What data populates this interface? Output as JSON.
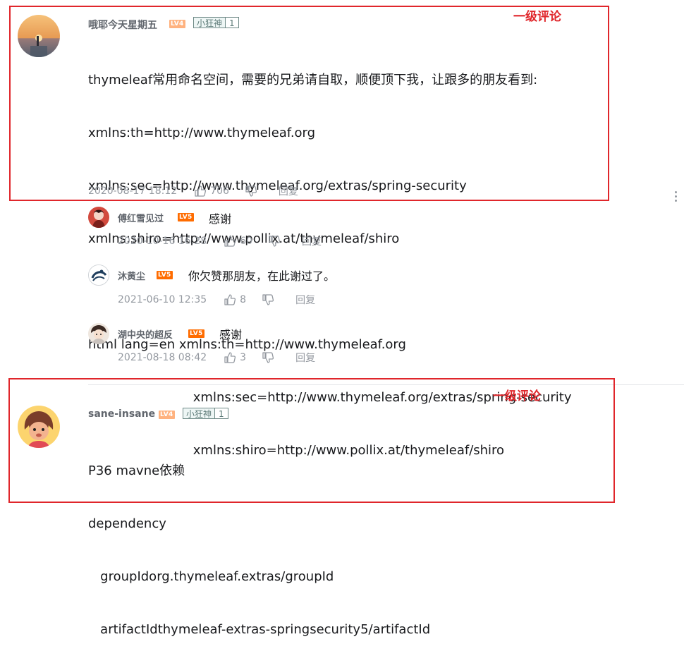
{
  "annotations": {
    "label_1": "一级评论",
    "label_2": "一级评论",
    "color": "#e0262b"
  },
  "comments": [
    {
      "username": "哦耶今天星期五",
      "level": "LV4",
      "fan_badge": {
        "name": "小狂神",
        "level": "1"
      },
      "lines": [
        "thymeleaf常用命名空间，需要的兄弟请自取，顺便顶下我，让跟多的朋友看到:",
        "xmlns:th=http://www.thymeleaf.org",
        "xmlns:sec=http://www.thymeleaf.org/extras/spring-security",
        "xmlns:shiro=http://www.pollix.at/thymeleaf/shiro",
        "",
        "html lang=en xmlns:th=http://www.thymeleaf.org",
        "                          xmlns:sec=http://www.thymeleaf.org/extras/spring-security",
        "                          xmlns:shiro=http://www.pollix.at/thymeleaf/shiro"
      ],
      "time": "2020-08-17 18:12",
      "likes": "706",
      "reply_label": "回复",
      "replies": [
        {
          "username": "傅红雪见过",
          "level": "LV5",
          "text": "感谢",
          "time": "2020-10-16 16:28",
          "likes": "60",
          "reply_label": "回复"
        },
        {
          "username": "沐黄尘",
          "level": "LV5",
          "text": "你欠赞那朋友，在此谢过了。",
          "time": "2021-06-10 12:35",
          "likes": "8",
          "reply_label": "回复"
        },
        {
          "username": "湖中央的超反",
          "level": "LV5",
          "text": "感谢",
          "time": "2021-08-18 08:42",
          "likes": "3",
          "reply_label": "回复"
        }
      ]
    },
    {
      "username": "sane-insane",
      "level": "LV4",
      "fan_badge": {
        "name": "小狂神",
        "level": "1"
      },
      "lines": [
        "P36 mavne依赖",
        "dependency",
        "   groupIdorg.thymeleaf.extras/groupId",
        "   artifactIdthymeleaf-extras-springsecurity5/artifactId"
      ]
    }
  ],
  "icons": {
    "like": "thumb-up-icon",
    "dislike": "thumb-down-icon",
    "more": "more-vertical-icon"
  }
}
